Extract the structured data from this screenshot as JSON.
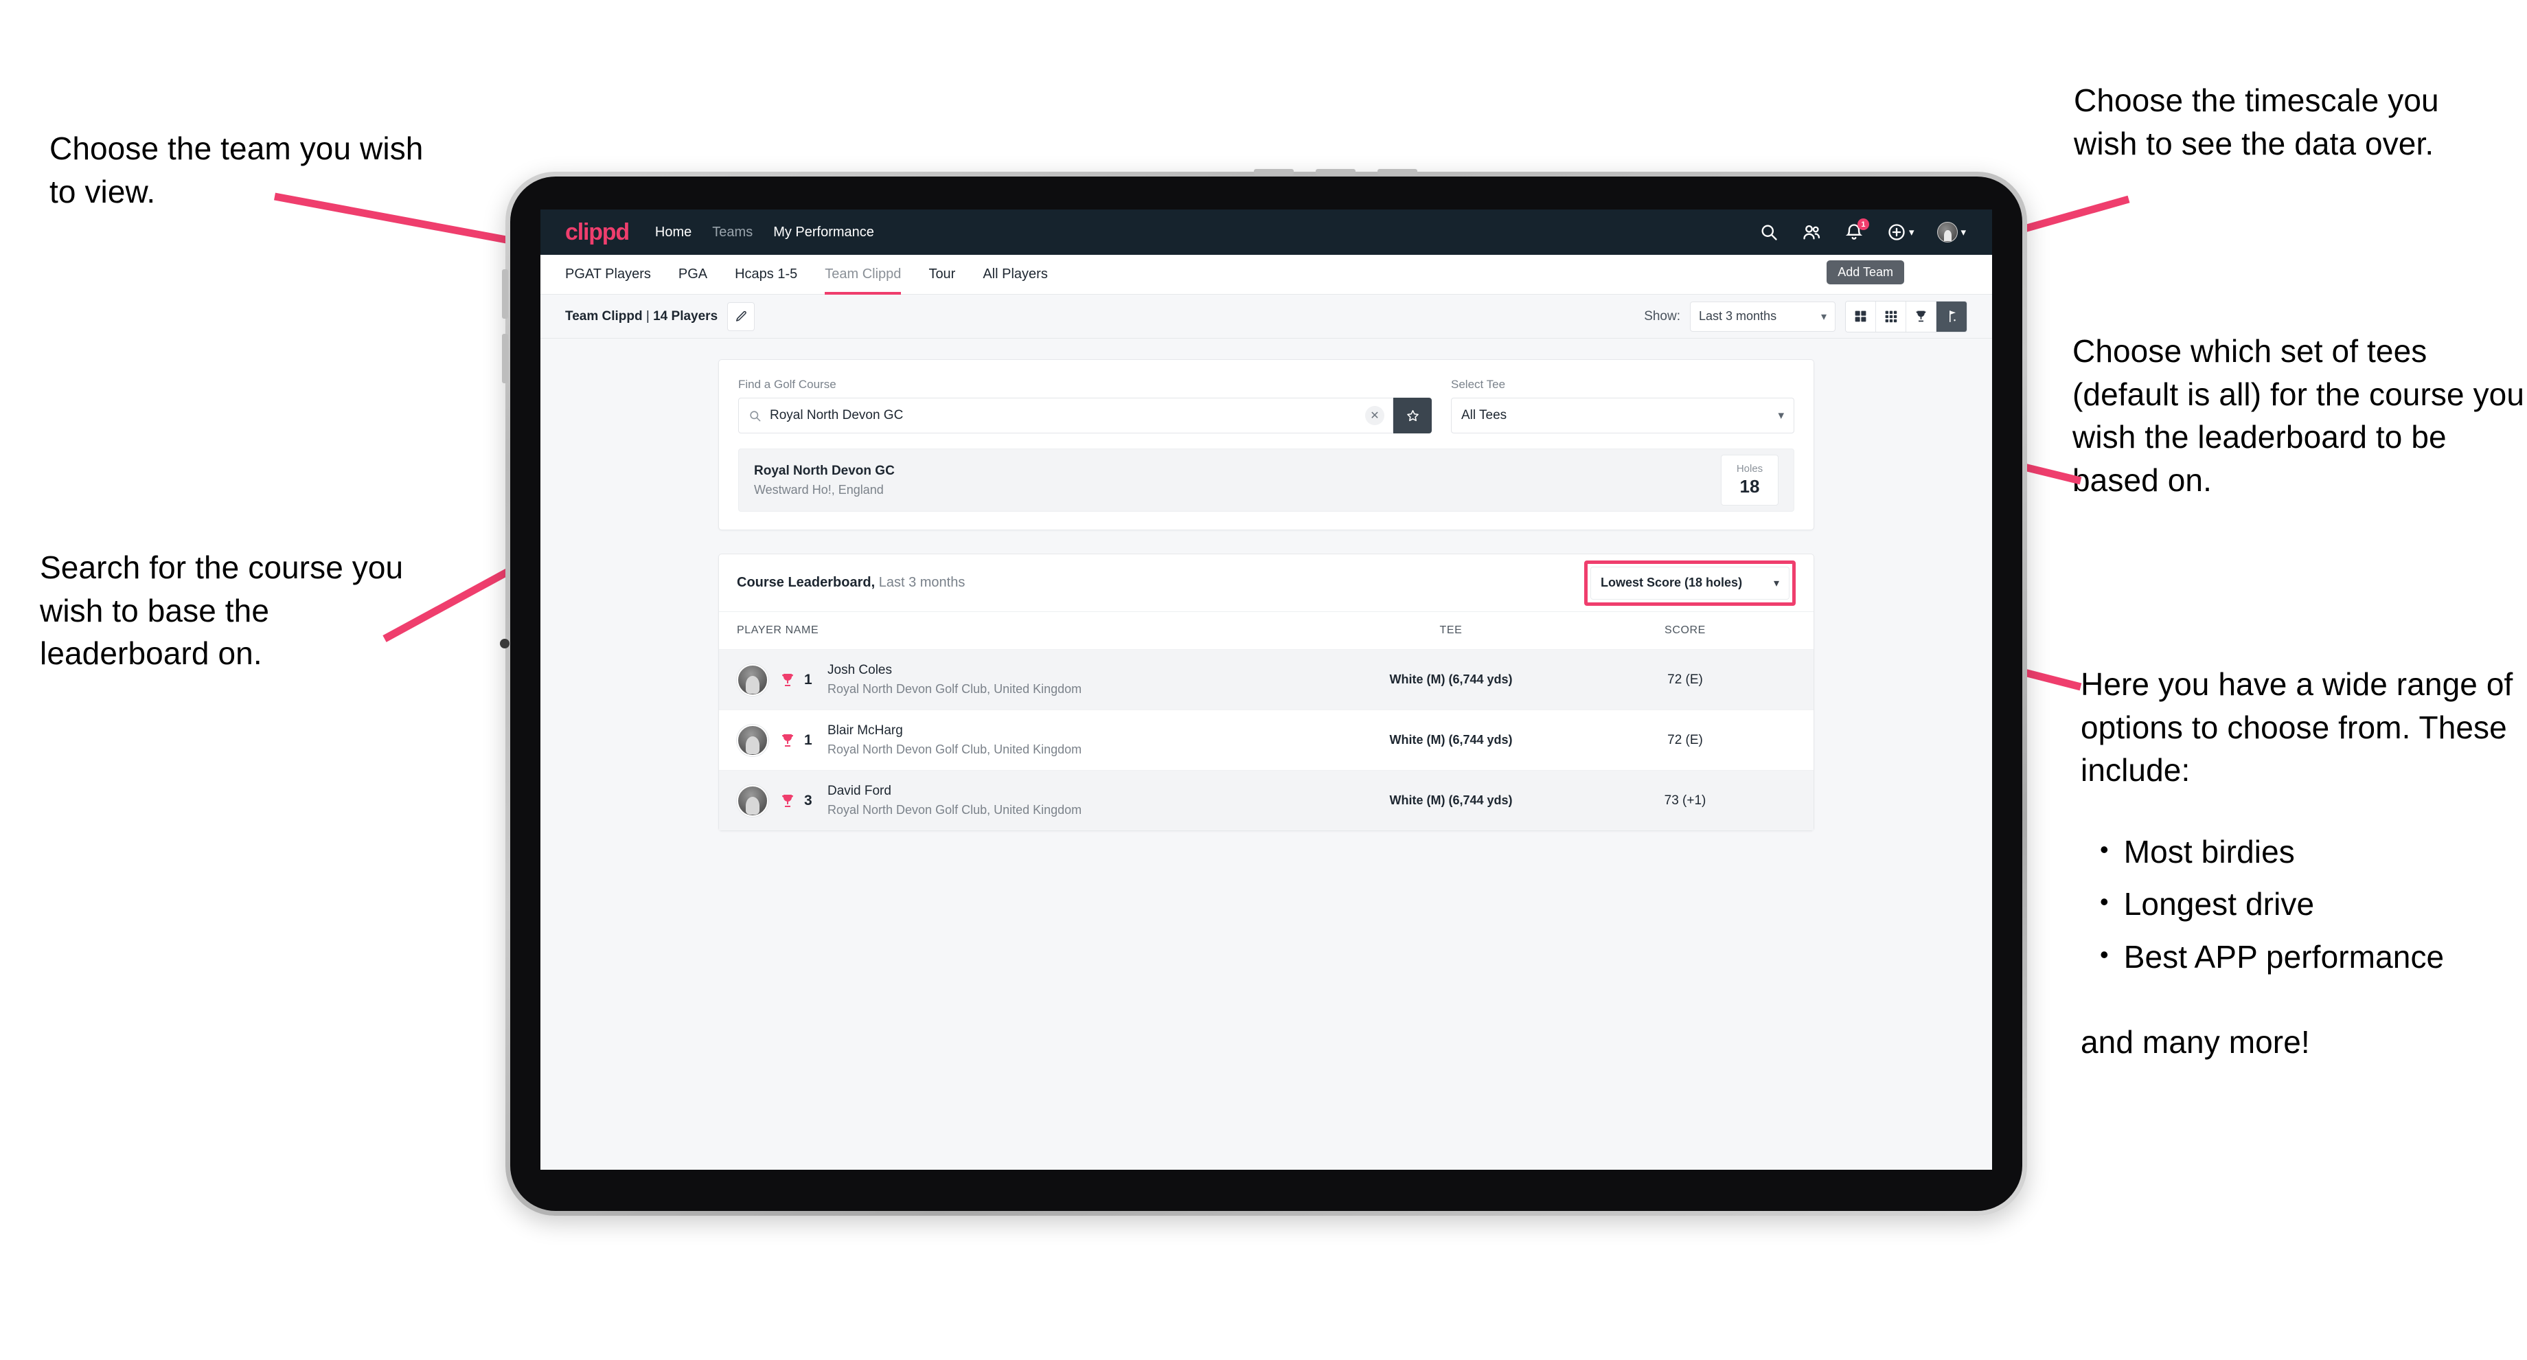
{
  "annotations": {
    "left_top": "Choose the team you wish to view.",
    "left_bottom": "Search for the course you wish to base the leaderboard on.",
    "right_top": "Choose the timescale you wish to see the data over.",
    "right_mid": "Choose which set of tees (default is all) for the course you wish the leaderboard to be based on.",
    "right_bottom_intro": "Here you have a wide range of options to choose from. These include:",
    "right_bottom_bullets": [
      "Most birdies",
      "Longest drive",
      "Best APP performance"
    ],
    "right_bottom_tail": "and many more!"
  },
  "app": {
    "brand": "clippd",
    "nav": [
      {
        "label": "Home",
        "active": true
      },
      {
        "label": "Teams",
        "active": false
      },
      {
        "label": "My Performance",
        "active": true
      }
    ],
    "icons": {
      "search": "search-icon",
      "people": "people-icon",
      "bell": "bell-icon",
      "bell_badge": "1",
      "plus": "plus-circle-icon",
      "avatar": "user-avatar"
    },
    "tooltip": "Add Team",
    "tabs": [
      {
        "label": "PGAT Players",
        "active": false
      },
      {
        "label": "PGA",
        "active": false
      },
      {
        "label": "Hcaps 1-5",
        "active": false
      },
      {
        "label": "Team Clippd",
        "active": true
      },
      {
        "label": "Tour",
        "active": false
      },
      {
        "label": "All Players",
        "active": false
      }
    ],
    "subbar": {
      "team_name": "Team Clippd",
      "separator": " | ",
      "player_count": "14 Players",
      "edit_icon": "pencil-icon",
      "show_label": "Show:",
      "timescale_value": "Last 3 months",
      "view_toggles": [
        {
          "name": "grid-large-view",
          "active": false
        },
        {
          "name": "grid-small-view",
          "active": false
        },
        {
          "name": "trophy-view",
          "active": false
        },
        {
          "name": "course-view",
          "active": true
        }
      ]
    },
    "search_panel": {
      "course_label": "Find a Golf Course",
      "course_value": "Royal North Devon GC",
      "course_placeholder": "Find a Golf Course",
      "clear_icon": "close-icon",
      "star_icon": "star-icon",
      "tee_label": "Select Tee",
      "tee_value": "All Tees"
    },
    "course_result": {
      "name": "Royal North Devon GC",
      "location": "Westward Ho!, England",
      "holes_label": "Holes",
      "holes_value": "18"
    },
    "leaderboard": {
      "title": "Course Leaderboard,",
      "subtitle": " Last 3 months",
      "sort_value": "Lowest Score (18 holes)",
      "columns": [
        "PLAYER NAME",
        "TEE",
        "SCORE"
      ],
      "rows": [
        {
          "rank": "1",
          "name": "Josh Coles",
          "club": "Royal North Devon Golf Club, United Kingdom",
          "tee": "White (M) (6,744 yds)",
          "score": "72 (E)"
        },
        {
          "rank": "1",
          "name": "Blair McHarg",
          "club": "Royal North Devon Golf Club, United Kingdom",
          "tee": "White (M) (6,744 yds)",
          "score": "72 (E)"
        },
        {
          "rank": "3",
          "name": "David Ford",
          "club": "Royal North Devon Golf Club, United Kingdom",
          "tee": "White (M) (6,744 yds)",
          "score": "73 (+1)"
        }
      ]
    }
  },
  "colors": {
    "accent_pink": "#ef3e6d",
    "navbar_dark": "#16232d",
    "page_bg": "#f6f7f9",
    "toggle_active": "#4b555f"
  }
}
